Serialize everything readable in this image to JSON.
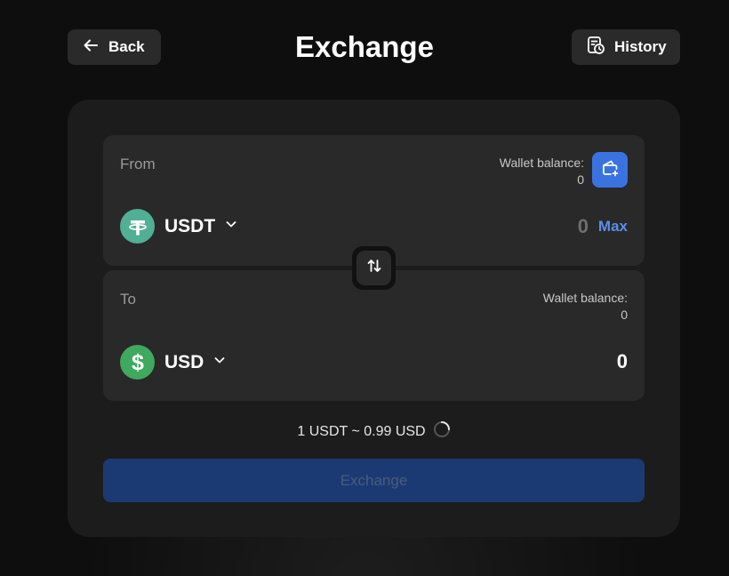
{
  "header": {
    "back_label": "Back",
    "title": "Exchange",
    "history_label": "History"
  },
  "from": {
    "label": "From",
    "wallet_balance_label": "Wallet balance:",
    "wallet_balance_value": "0",
    "asset": "USDT",
    "amount": "0",
    "max_label": "Max"
  },
  "to": {
    "label": "To",
    "wallet_balance_label": "Wallet balance:",
    "wallet_balance_value": "0",
    "asset": "USD",
    "amount": "0"
  },
  "rate": {
    "text": "1 USDT ~ 0.99 USD"
  },
  "action": {
    "exchange_label": "Exchange"
  },
  "colors": {
    "accent": "#3a73e0",
    "usdt": "#50af95",
    "usd": "#3fa95f",
    "exchange_disabled": "#1b3a74"
  },
  "icons": {
    "back": "arrow-left-icon",
    "history": "history-icon",
    "wallet": "wallet-add-icon",
    "swap": "swap-vertical-icon",
    "loading": "spinner-icon"
  }
}
